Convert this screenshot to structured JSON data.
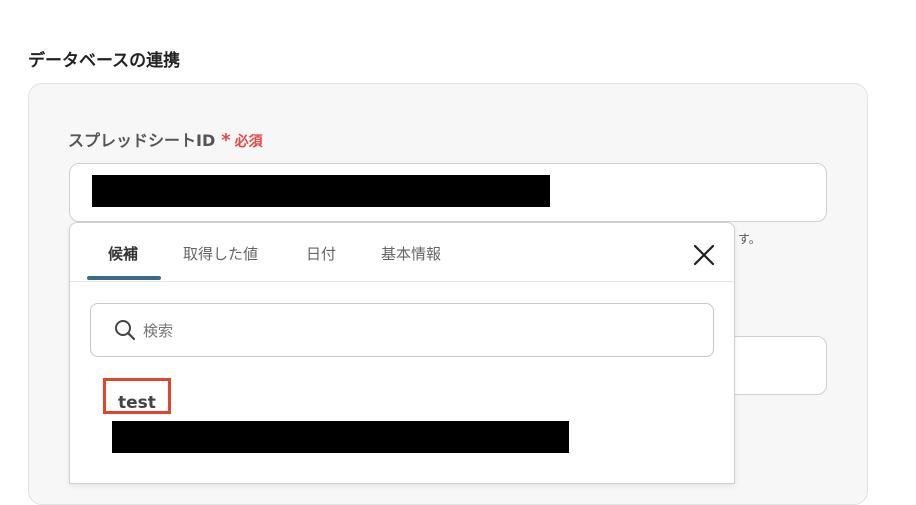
{
  "section": {
    "title": "データベースの連携"
  },
  "field": {
    "label": "スプレッドシートID",
    "required_mark": "*",
    "required_text": "必須",
    "hint_tail": "す。"
  },
  "dropdown": {
    "tabs": [
      {
        "label": "候補",
        "active": true
      },
      {
        "label": "取得した値",
        "active": false
      },
      {
        "label": "日付",
        "active": false
      },
      {
        "label": "基本情報",
        "active": false
      }
    ],
    "close_icon": "close-icon",
    "search": {
      "placeholder": "検索",
      "value": "",
      "icon": "search-icon"
    },
    "results": [
      {
        "title": "test"
      }
    ]
  },
  "colors": {
    "accent": "#3a6a86",
    "required": "#e24a4a",
    "highlight": "#e2452c",
    "panel_bg": "#f7f7f7"
  }
}
